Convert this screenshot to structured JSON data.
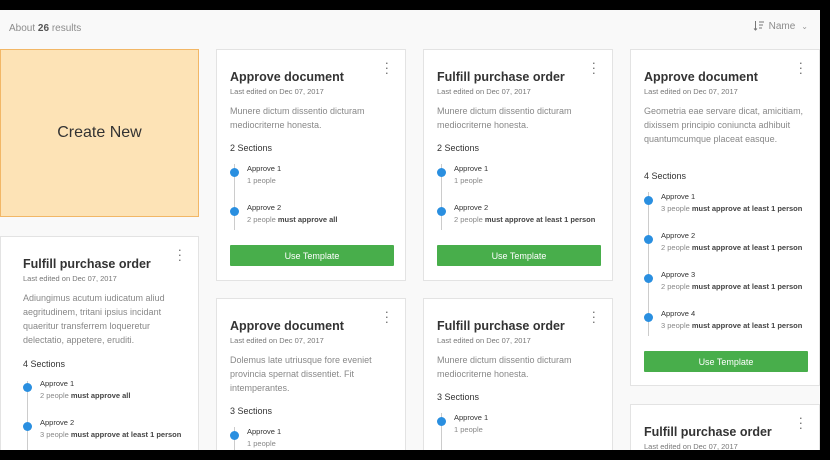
{
  "header": {
    "results_prefix": "About",
    "results_count": "26",
    "results_suffix": "results",
    "sort_label": "Name",
    "sort_icon": "sort-icon",
    "chevron_icon": "chevron-down-icon"
  },
  "create_new": {
    "label": "Create New"
  },
  "use_template_label": "Use Template",
  "colors": {
    "accent_green": "#48ae4b",
    "step_blue": "#2a8fe0",
    "create_bg": "#fde3b6"
  },
  "cards": [
    {
      "title": "Fulfill purchase order",
      "edited": "Last edited on Dec 07, 2017",
      "desc": "Adiungimus acutum iudicatum aliud aegritudinem, tritani ipsius incidant quaeritur transferrem loqueretur delectatio, appetere, eruditi.",
      "sections": "4 Sections",
      "steps": [
        {
          "name": "Approve 1",
          "count": "2 people",
          "rule": "must approve all"
        },
        {
          "name": "Approve 2",
          "count": "3 people",
          "rule": "must approve at least 1 person"
        }
      ]
    },
    {
      "title": "Approve document",
      "edited": "Last edited on Dec 07, 2017",
      "desc": "Munere dictum dissentio dicturam mediocriterne honesta.",
      "sections": "2 Sections",
      "steps": [
        {
          "name": "Approve 1",
          "count": "1 people",
          "rule": ""
        },
        {
          "name": "Approve 2",
          "count": "2 people",
          "rule": "must approve all"
        }
      ]
    },
    {
      "title": "Approve document",
      "edited": "Last edited on Dec 07, 2017",
      "desc": "Dolemus late utriusque fore eveniet provincia spernat dissentiet. Fit intemperantes.",
      "sections": "3 Sections",
      "steps": [
        {
          "name": "Approve 1",
          "count": "1 people",
          "rule": ""
        }
      ]
    },
    {
      "title": "Fulfill purchase order",
      "edited": "Last edited on Dec 07, 2017",
      "desc": "Munere dictum dissentio dicturam mediocriterne honesta.",
      "sections": "2 Sections",
      "steps": [
        {
          "name": "Approve 1",
          "count": "1 people",
          "rule": ""
        },
        {
          "name": "Approve 2",
          "count": "2 people",
          "rule": "must approve at least 1 person"
        }
      ]
    },
    {
      "title": "Fulfill purchase order",
      "edited": "Last edited on Dec 07, 2017",
      "desc": "Munere dictum dissentio dicturam mediocriterne honesta.",
      "sections": "3 Sections",
      "steps": [
        {
          "name": "Approve 1",
          "count": "1 people",
          "rule": ""
        }
      ]
    },
    {
      "title": "Approve document",
      "edited": "Last edited on Dec 07, 2017",
      "desc": "Geometria eae servare dicat, amicitiam, dixissem principio coniuncta adhibuit quantumcumque placeat easque.",
      "sections": "4 Sections",
      "steps": [
        {
          "name": "Approve 1",
          "count": "3 people",
          "rule": "must approve at least 1 person"
        },
        {
          "name": "Approve 2",
          "count": "2 people",
          "rule": "must approve at least 1 person"
        },
        {
          "name": "Approve 3",
          "count": "2 people",
          "rule": "must approve at least 1 person"
        },
        {
          "name": "Approve 4",
          "count": "3 people",
          "rule": "must approve at least 1 person"
        }
      ]
    },
    {
      "title": "Fulfill purchase order",
      "edited": "Last edited on Dec 07, 2017"
    }
  ]
}
